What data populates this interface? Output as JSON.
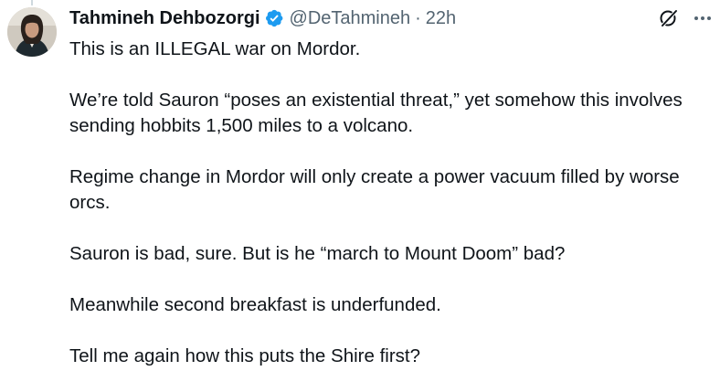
{
  "author": {
    "display_name": "Tahmineh Dehbozorgi",
    "handle": "@DeTahmineh",
    "separator": "·",
    "time": "22h",
    "avatar_icon": "user-avatar",
    "verified_icon": "verified-badge-icon",
    "verified_color": "#1d9bf0"
  },
  "actions": {
    "grok_icon": "grok-icon",
    "more_icon": "more-options-icon"
  },
  "tweet": {
    "paragraphs": [
      "This is an ILLEGAL war on Mordor.",
      "We’re told Sauron “poses an existential threat,” yet somehow this involves sending hobbits 1,500 miles to a volcano.",
      "Regime change in Mordor will only create a power vacuum filled by worse orcs.",
      "Sauron is bad, sure. But is he “march to Mount Doom” bad?",
      "Meanwhile second breakfast is underfunded.",
      "Tell me again how this puts the Shire first?"
    ]
  },
  "colors": {
    "text": "#0f1419",
    "secondary": "#536471",
    "background": "#ffffff"
  }
}
